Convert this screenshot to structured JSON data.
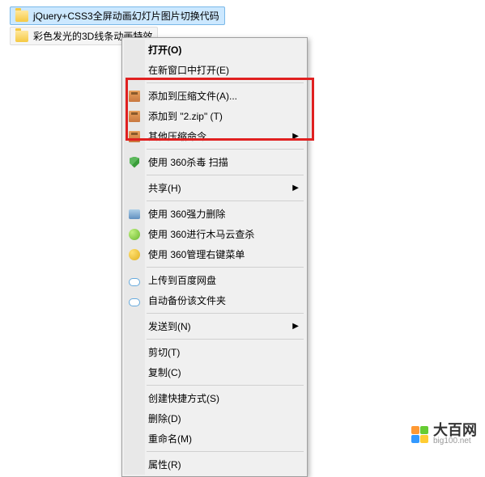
{
  "files": [
    {
      "name": "jQuery+CSS3全屏动画幻灯片图片切换代码"
    },
    {
      "name": "彩色发光的3D线条动画特效"
    }
  ],
  "menu": {
    "open": "打开(O)",
    "open_new": "在新窗口中打开(E)",
    "add_archive": "添加到压缩文件(A)...",
    "add_zip": "添加到 \"2.zip\" (T)",
    "other_compress": "其他压缩命令",
    "scan_360": "使用 360杀毒 扫描",
    "share": "共享(H)",
    "force_delete": "使用 360强力删除",
    "trojan_scan": "使用 360进行木马云查杀",
    "manage_menu": "使用 360管理右键菜单",
    "upload_baidu": "上传到百度网盘",
    "auto_backup": "自动备份该文件夹",
    "send_to": "发送到(N)",
    "cut": "剪切(T)",
    "copy": "复制(C)",
    "shortcut": "创建快捷方式(S)",
    "delete": "删除(D)",
    "rename": "重命名(M)",
    "properties": "属性(R)"
  },
  "watermark": {
    "title": "大百网",
    "url": "big100.net"
  }
}
